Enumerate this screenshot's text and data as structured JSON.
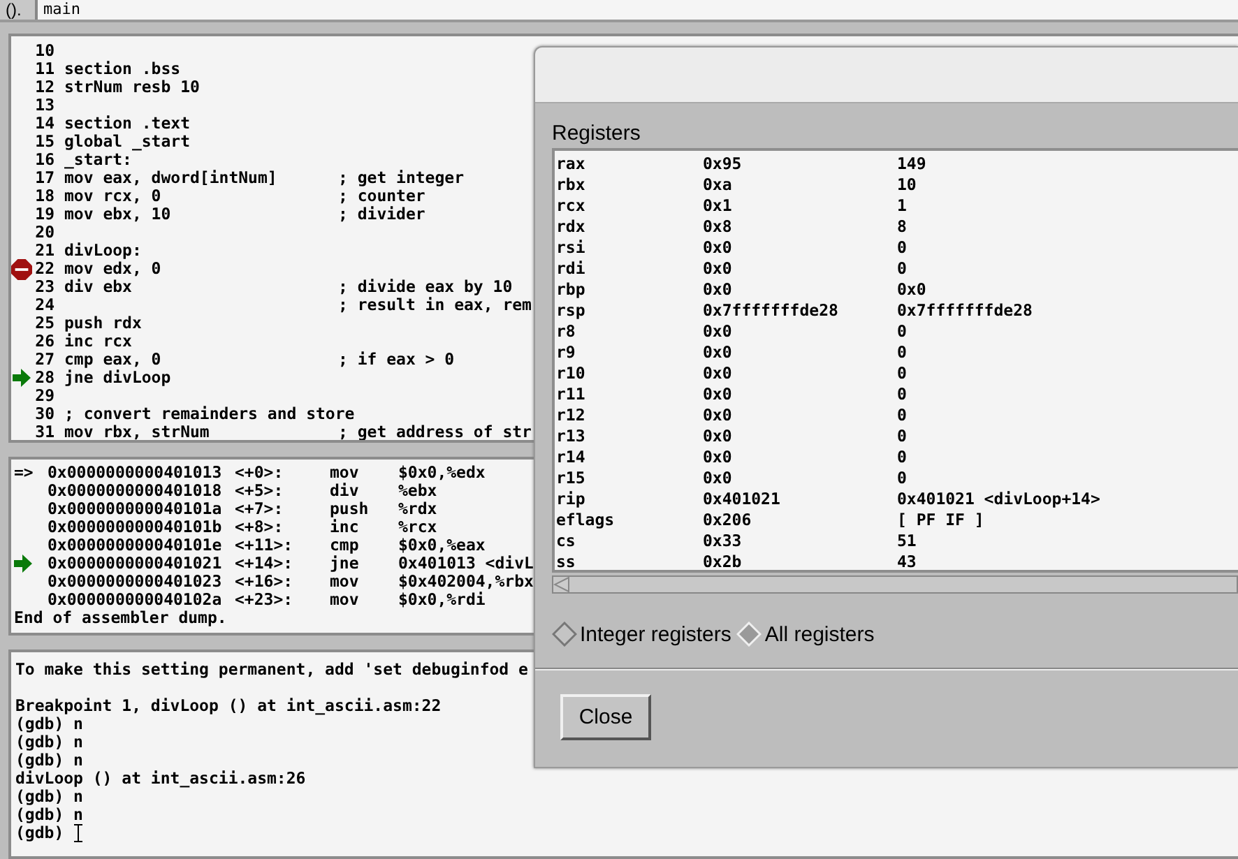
{
  "toolbar": {
    "label": "().",
    "argument": "main"
  },
  "source": [
    {
      "num": "10",
      "breakpoint": false,
      "current": false
    },
    {
      "num": "11",
      "code": "section .bss",
      "breakpoint": false,
      "current": false
    },
    {
      "num": "12",
      "code": "strNum resb 10",
      "breakpoint": false,
      "current": false
    },
    {
      "num": "13",
      "breakpoint": false,
      "current": false
    },
    {
      "num": "14",
      "code": "section .text",
      "breakpoint": false,
      "current": false
    },
    {
      "num": "15",
      "code": "global _start",
      "breakpoint": false,
      "current": false
    },
    {
      "num": "16",
      "code": "_start:",
      "breakpoint": false,
      "current": false
    },
    {
      "num": "17",
      "code": "mov eax, dword[intNum]",
      "comment": "; get integer",
      "breakpoint": false,
      "current": false
    },
    {
      "num": "18",
      "code": "mov rcx, 0",
      "comment": "; counter",
      "breakpoint": false,
      "current": false
    },
    {
      "num": "19",
      "code": "mov ebx, 10",
      "comment": "; divider",
      "breakpoint": false,
      "current": false
    },
    {
      "num": "20",
      "breakpoint": false,
      "current": false
    },
    {
      "num": "21",
      "code": "divLoop:",
      "breakpoint": false,
      "current": false
    },
    {
      "num": "22",
      "code": "mov edx, 0",
      "breakpoint": true,
      "current": false
    },
    {
      "num": "23",
      "code": "div ebx",
      "comment": "; divide eax by 10",
      "breakpoint": false,
      "current": false
    },
    {
      "num": "24",
      "comment": "; result in eax, rem",
      "breakpoint": false,
      "current": false
    },
    {
      "num": "25",
      "code": "push rdx",
      "breakpoint": false,
      "current": false
    },
    {
      "num": "26",
      "code": "inc rcx",
      "breakpoint": false,
      "current": false
    },
    {
      "num": "27",
      "code": "cmp eax, 0",
      "comment": "; if eax > 0",
      "breakpoint": false,
      "current": false
    },
    {
      "num": "28",
      "code": "jne divLoop",
      "breakpoint": false,
      "current": true
    },
    {
      "num": "29",
      "breakpoint": false,
      "current": false
    },
    {
      "num": "30",
      "code": "; convert remainders and store",
      "breakpoint": false,
      "current": false
    },
    {
      "num": "31",
      "code": "mov rbx, strNum",
      "comment": "; get address of str",
      "breakpoint": false,
      "current": false
    }
  ],
  "disassembly": [
    {
      "marker": "=>",
      "address": "0x0000000000401013",
      "offset": "<+0>:",
      "mnemonic": "mov",
      "operands": "$0x0,%edx",
      "current": false
    },
    {
      "address": "0x0000000000401018",
      "offset": "<+5>:",
      "mnemonic": "div",
      "operands": "%ebx",
      "current": false
    },
    {
      "address": "0x000000000040101a",
      "offset": "<+7>:",
      "mnemonic": "push",
      "operands": "%rdx",
      "current": false
    },
    {
      "address": "0x000000000040101b",
      "offset": "<+8>:",
      "mnemonic": "inc",
      "operands": "%rcx",
      "current": false
    },
    {
      "address": "0x000000000040101e",
      "offset": "<+11>:",
      "mnemonic": "cmp",
      "operands": "$0x0,%eax",
      "current": false
    },
    {
      "address": "0x0000000000401021",
      "offset": "<+14>:",
      "mnemonic": "jne",
      "operands": "0x401013 <divL",
      "current": true
    },
    {
      "address": "0x0000000000401023",
      "offset": "<+16>:",
      "mnemonic": "mov",
      "operands": "$0x402004,%rbx",
      "current": false
    },
    {
      "address": "0x000000000040102a",
      "offset": "<+23>:",
      "mnemonic": "mov",
      "operands": "$0x0,%rdi",
      "current": false
    }
  ],
  "disassembly_footer": "End of assembler dump.",
  "console": [
    {
      "lines": [
        "To make this setting permanent, add 'set debuginfod e"
      ]
    },
    {
      "lines": [
        "Breakpoint 1, divLoop () at int_ascii.asm:22",
        "(gdb) n",
        "(gdb) n",
        "(gdb) n",
        "divLoop () at int_ascii.asm:26",
        "(gdb) n",
        "(gdb) n",
        "(gdb)"
      ]
    }
  ],
  "registers_dialog": {
    "title": "Registers",
    "rows": [
      {
        "name": "rax",
        "hex": "0x95",
        "natural": "149"
      },
      {
        "name": "rbx",
        "hex": "0xa",
        "natural": "10"
      },
      {
        "name": "rcx",
        "hex": "0x1",
        "natural": "1"
      },
      {
        "name": "rdx",
        "hex": "0x8",
        "natural": "8"
      },
      {
        "name": "rsi",
        "hex": "0x0",
        "natural": "0"
      },
      {
        "name": "rdi",
        "hex": "0x0",
        "natural": "0"
      },
      {
        "name": "rbp",
        "hex": "0x0",
        "natural": "0x0"
      },
      {
        "name": "rsp",
        "hex": "0x7fffffffde28",
        "natural": "0x7fffffffde28"
      },
      {
        "name": "r8",
        "hex": "0x0",
        "natural": "0"
      },
      {
        "name": "r9",
        "hex": "0x0",
        "natural": "0"
      },
      {
        "name": "r10",
        "hex": "0x0",
        "natural": "0"
      },
      {
        "name": "r11",
        "hex": "0x0",
        "natural": "0"
      },
      {
        "name": "r12",
        "hex": "0x0",
        "natural": "0"
      },
      {
        "name": "r13",
        "hex": "0x0",
        "natural": "0"
      },
      {
        "name": "r14",
        "hex": "0x0",
        "natural": "0"
      },
      {
        "name": "r15",
        "hex": "0x0",
        "natural": "0"
      },
      {
        "name": "rip",
        "hex": "0x401021",
        "natural": "0x401021 <divLoop+14>"
      },
      {
        "name": "eflags",
        "hex": "0x206",
        "natural": "[ PF IF ]"
      },
      {
        "name": "cs",
        "hex": "0x33",
        "natural": "51"
      },
      {
        "name": "ss",
        "hex": "0x2b",
        "natural": "43"
      }
    ],
    "radios": [
      {
        "label": "Integer registers",
        "selected": false
      },
      {
        "label": "All registers",
        "selected": true
      }
    ],
    "close_button": "Close"
  }
}
